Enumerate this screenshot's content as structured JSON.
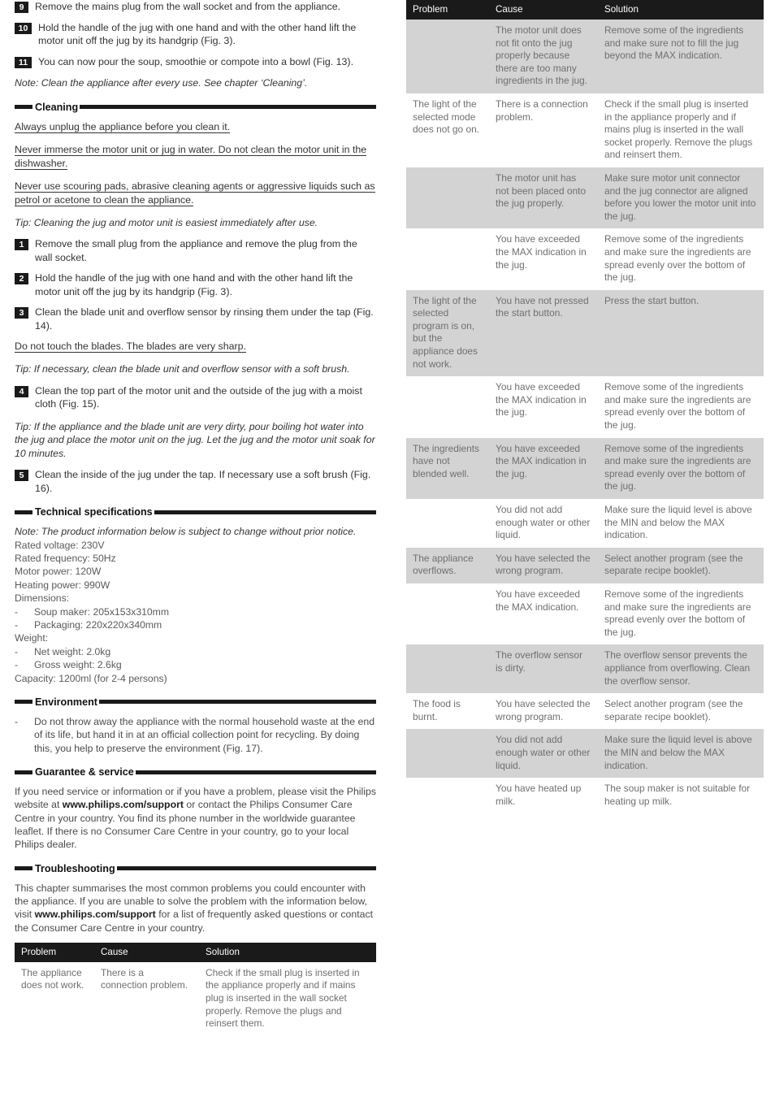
{
  "left": {
    "steps_top": [
      {
        "num": "9",
        "text": "Remove the mains plug from the wall socket and from the appliance."
      },
      {
        "num": "10",
        "text": "Hold the handle of the jug with one hand and with the other hand lift the motor unit off the jug by its handgrip (Fig. 3)."
      },
      {
        "num": "11",
        "text": "You can now pour the soup, smoothie or compote into a bowl (Fig. 13)."
      }
    ],
    "note_top": "Note: Clean the appliance after every use. See chapter ‘Cleaning’.",
    "cleaning": {
      "heading": "Cleaning",
      "warnings": [
        "Always unplug the appliance before you clean it.",
        "Never immerse the motor unit or jug in water. Do not clean the motor unit in the dishwasher.",
        "Never use scouring pads, abrasive cleaning agents or aggressive liquids such as petrol or acetone to clean the appliance."
      ],
      "tip1": "Tip: Cleaning the jug and motor unit is easiest immediately after use.",
      "steps_a": [
        {
          "num": "1",
          "text": "Remove the small plug from the appliance and remove the plug from the wall socket."
        },
        {
          "num": "2",
          "text": "Hold the handle of the jug with one hand and with the other hand lift the motor unit off the jug by its handgrip (Fig. 3)."
        },
        {
          "num": "3",
          "text": "Clean the blade unit and overflow sensor by rinsing them under the tap (Fig. 14)."
        }
      ],
      "warning_blades": "Do not touch the blades. The blades are very sharp.",
      "tip2": "Tip: If necessary, clean the blade unit and overflow sensor with a soft brush.",
      "steps_b": [
        {
          "num": "4",
          "text": "Clean the top part of the motor unit and the outside of the jug with a moist cloth (Fig. 15)."
        }
      ],
      "tip3": "Tip: If the appliance and the blade unit are very dirty, pour boiling hot water into the jug and place the motor unit on the jug. Let the jug and the motor unit soak for 10 minutes.",
      "steps_c": [
        {
          "num": "5",
          "text": "Clean the inside of the jug under the tap. If necessary use a soft brush (Fig. 16)."
        }
      ]
    },
    "tech": {
      "heading": "Technical specifications",
      "note": "Note: The product information below is subject to change without prior notice.",
      "lines": [
        {
          "type": "plain",
          "text": "Rated voltage: 230V"
        },
        {
          "type": "plain",
          "text": "Rated frequency: 50Hz"
        },
        {
          "type": "plain",
          "text": "Motor power: 120W"
        },
        {
          "type": "plain",
          "text": "Heating power: 990W"
        },
        {
          "type": "plain",
          "text": "Dimensions:"
        },
        {
          "type": "dash",
          "text": "Soup maker: 205x153x310mm"
        },
        {
          "type": "dash",
          "text": "Packaging: 220x220x340mm"
        },
        {
          "type": "plain",
          "text": "Weight:"
        },
        {
          "type": "dash",
          "text": "Net weight: 2.0kg"
        },
        {
          "type": "dash",
          "text": "Gross weight: 2.6kg"
        },
        {
          "type": "plain",
          "text": "Capacity: 1200ml (for 2-4 persons)"
        }
      ]
    },
    "environment": {
      "heading": "Environment",
      "bullet": "Do not throw away the appliance with the normal household waste at the end of its life, but hand it in at an official collection point for recycling. By doing this, you help to preserve the environment (Fig. 17)."
    },
    "guarantee": {
      "heading": "Guarantee & service",
      "text_a": "If you need service or information or if you have a problem, please visit the Philips website at ",
      "link": "www.philips.com/support",
      "text_b": " or contact the Philips Consumer Care Centre in your country. You find its phone number in the worldwide guarantee leaflet. If there is no Consumer Care Centre in your country, go to your local Philips dealer."
    },
    "troubleshooting": {
      "heading": "Troubleshooting",
      "intro_a": "This chapter summarises the most common problems you could encounter with the appliance. If you are unable to solve the problem with the information below, visit ",
      "intro_link": "www.philips.com/support",
      "intro_b": " for a list of frequently asked questions or contact the Consumer Care Centre in your country."
    },
    "table": {
      "columns": [
        "Problem",
        "Cause",
        "Solution"
      ],
      "rows": [
        {
          "shade": false,
          "problem": "The appliance does not work.",
          "cause": "There is a connection problem.",
          "solution": "Check if the small plug is inserted in the appliance properly and if mains plug is inserted in the wall socket properly. Remove the plugs and reinsert them."
        }
      ]
    }
  },
  "right": {
    "table": {
      "columns": [
        "Problem",
        "Cause",
        "Solution"
      ],
      "rows": [
        {
          "shade": true,
          "problem": "",
          "cause": "The motor unit does not fit onto the jug properly because there are too many ingredients in the jug.",
          "solution": "Remove some of the ingredients and make sure not to fill the jug beyond the MAX indication."
        },
        {
          "shade": false,
          "problem": "The light of the selected mode does not go on.",
          "cause": "There is a connection problem.",
          "solution": "Check if the small plug is inserted in the appliance properly and if mains plug is inserted in the wall socket properly. Remove the plugs and reinsert them."
        },
        {
          "shade": true,
          "problem": "",
          "cause": "The motor unit has not been placed onto the jug properly.",
          "solution": "Make sure motor unit connector and the jug connector are aligned before you lower the motor unit into the jug."
        },
        {
          "shade": false,
          "problem": "",
          "cause": "You have exceeded the MAX indication in the jug.",
          "solution": "Remove some of the ingredients and make sure the ingredients are spread evenly over the bottom of the jug."
        },
        {
          "shade": true,
          "problem": "The light of the selected program is on, but the appliance does not work.",
          "cause": "You have not pressed the start button.",
          "solution": "Press the start button."
        },
        {
          "shade": false,
          "problem": "",
          "cause": "You have exceeded the MAX indication in the jug.",
          "solution": "Remove some of the ingredients and make sure the ingredients are spread evenly over the bottom of the jug."
        },
        {
          "shade": true,
          "problem": "The ingredients have not blended well.",
          "cause": "You have exceeded the MAX indication in the jug.",
          "solution": "Remove some of the ingredients and make sure the ingredients are spread evenly over the bottom of the jug."
        },
        {
          "shade": false,
          "problem": "",
          "cause": "You did not add enough water or other liquid.",
          "solution": "Make sure the liquid level is above the MIN and below the MAX indication."
        },
        {
          "shade": true,
          "problem": "The appliance overflows.",
          "cause": "You have selected the wrong program.",
          "solution": "Select another program (see the separate recipe booklet)."
        },
        {
          "shade": false,
          "problem": "",
          "cause": "You have exceeded the MAX indication.",
          "solution": "Remove some of the ingredients and make sure the ingredients are spread evenly over the bottom of the jug."
        },
        {
          "shade": true,
          "problem": "",
          "cause": "The overflow sensor is dirty.",
          "solution": "The overflow sensor prevents the appliance from overflowing. Clean the overflow sensor."
        },
        {
          "shade": false,
          "problem": "The food is burnt.",
          "cause": "You have selected the wrong program.",
          "solution": "Select another program (see the separate recipe booklet)."
        },
        {
          "shade": true,
          "problem": "",
          "cause": "You did not add enough water or other liquid.",
          "solution": "Make sure the liquid level is above the MIN and below the MAX indication."
        },
        {
          "shade": false,
          "problem": "",
          "cause": "You have heated up milk.",
          "solution": "The soup maker is not suitable for heating up milk."
        }
      ]
    }
  }
}
